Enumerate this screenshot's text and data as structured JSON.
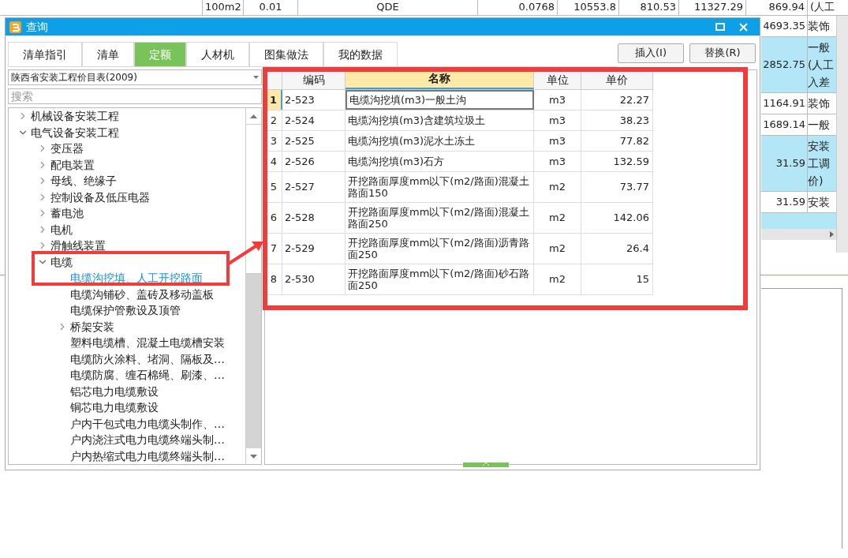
{
  "background_sheet": {
    "top_row": [
      "100m2",
      "0.01",
      "QDE",
      "0.0768",
      "10553.8",
      "810.53",
      "11327.29",
      "869.94",
      "(人工"
    ],
    "right_rows": [
      {
        "value": "4693.35",
        "lines": [
          "装饰"
        ],
        "highlighted": false
      },
      {
        "value": "2852.75",
        "lines": [
          "一般",
          "(人工",
          "入差"
        ],
        "highlighted": true
      },
      {
        "value": "1164.91",
        "lines": [
          "装饰"
        ],
        "highlighted": false
      },
      {
        "value": "1689.14",
        "lines": [
          "一般"
        ],
        "highlighted": false
      },
      {
        "value": "31.59",
        "lines": [
          "安装",
          "工调",
          "价)"
        ],
        "highlighted": true
      },
      {
        "value": "31.59",
        "lines": [
          "安装"
        ],
        "highlighted": false
      }
    ]
  },
  "dialog": {
    "title": "查询",
    "tabs": [
      {
        "label": "清单指引",
        "selected": false
      },
      {
        "label": "清单",
        "selected": false
      },
      {
        "label": "定额",
        "selected": true
      },
      {
        "label": "人材机",
        "selected": false
      },
      {
        "label": "图集做法",
        "selected": false
      },
      {
        "label": "我的数据",
        "selected": false
      }
    ],
    "buttons": [
      "插入(I)",
      "替换(R)"
    ],
    "library": "陕西省安装工程价目表(2009)",
    "search": {
      "placeholder": "搜索"
    },
    "tree": [
      {
        "label": "机械设备安装工程",
        "expanded": false,
        "selected": false
      },
      {
        "label": "电气设备安装工程",
        "expanded": true,
        "selected": false,
        "children": [
          {
            "label": "变压器",
            "expanded": false,
            "selected": false
          },
          {
            "label": "配电装置",
            "expanded": false,
            "selected": false
          },
          {
            "label": "母线、绝缘子",
            "expanded": false,
            "selected": false
          },
          {
            "label": "控制设备及低压电器",
            "expanded": false,
            "selected": false
          },
          {
            "label": "蓄电池",
            "expanded": false,
            "selected": false
          },
          {
            "label": "电机",
            "expanded": false,
            "selected": false
          },
          {
            "label": "滑触线装置",
            "expanded": false,
            "selected": false
          },
          {
            "label": "电缆",
            "expanded": true,
            "selected": false,
            "children": [
              {
                "label": "电缆沟挖填、人工开挖路面",
                "selected": true
              },
              {
                "label": "电缆沟铺砂、盖砖及移动盖板",
                "selected": false
              },
              {
                "label": "电缆保护管敷设及顶管",
                "selected": false
              },
              {
                "label": "桥架安装",
                "expanded": false,
                "selected": false
              },
              {
                "label": "塑料电缆槽、混凝土电缆槽安装",
                "selected": false
              },
              {
                "label": "电缆防火涂料、堵洞、隔板及…",
                "selected": false
              },
              {
                "label": "电缆防腐、缠石棉绳、刷漆、…",
                "selected": false
              },
              {
                "label": "铝芯电力电缆敷设",
                "selected": false
              },
              {
                "label": "铜芯电力电缆敷设",
                "selected": false
              },
              {
                "label": "户内干包式电力电缆头制作、…",
                "selected": false
              },
              {
                "label": "户内浇注式电力电缆终端头制…",
                "selected": false
              },
              {
                "label": "户内热缩式电力电缆终端头制…",
                "selected": false
              }
            ]
          }
        ]
      }
    ],
    "table": {
      "columns": [
        {
          "label": "编码",
          "selected": false
        },
        {
          "label": "名称",
          "selected": true
        },
        {
          "label": "单位",
          "selected": false
        },
        {
          "label": "单价",
          "selected": false
        }
      ],
      "rows": [
        {
          "index": "1",
          "code": "2-523",
          "name": "电缆沟挖填(m3)一般土沟",
          "unit": "m3",
          "price": "22.27",
          "selected": true
        },
        {
          "index": "2",
          "code": "2-524",
          "name": "电缆沟挖填(m3)含建筑垃圾土",
          "unit": "m3",
          "price": "38.23",
          "selected": false
        },
        {
          "index": "3",
          "code": "2-525",
          "name": "电缆沟挖填(m3)泥水土冻土",
          "unit": "m3",
          "price": "77.82",
          "selected": false
        },
        {
          "index": "4",
          "code": "2-526",
          "name": "电缆沟挖填(m3)石方",
          "unit": "m3",
          "price": "132.59",
          "selected": false
        },
        {
          "index": "5",
          "code": "2-527",
          "name": "开挖路面厚度mm以下(m2/路面)混凝土路面150",
          "unit": "m2",
          "price": "73.77",
          "selected": false
        },
        {
          "index": "6",
          "code": "2-528",
          "name": "开挖路面厚度mm以下(m2/路面)混凝土路面250",
          "unit": "m2",
          "price": "142.06",
          "selected": false
        },
        {
          "index": "7",
          "code": "2-529",
          "name": "开挖路面厚度mm以下(m2/路面)沥青路面250",
          "unit": "m2",
          "price": "26.4",
          "selected": false
        },
        {
          "index": "8",
          "code": "2-530",
          "name": "开挖路面厚度mm以下(m2/路面)砂石路面250",
          "unit": "m2",
          "price": "15",
          "selected": false
        }
      ]
    }
  }
}
